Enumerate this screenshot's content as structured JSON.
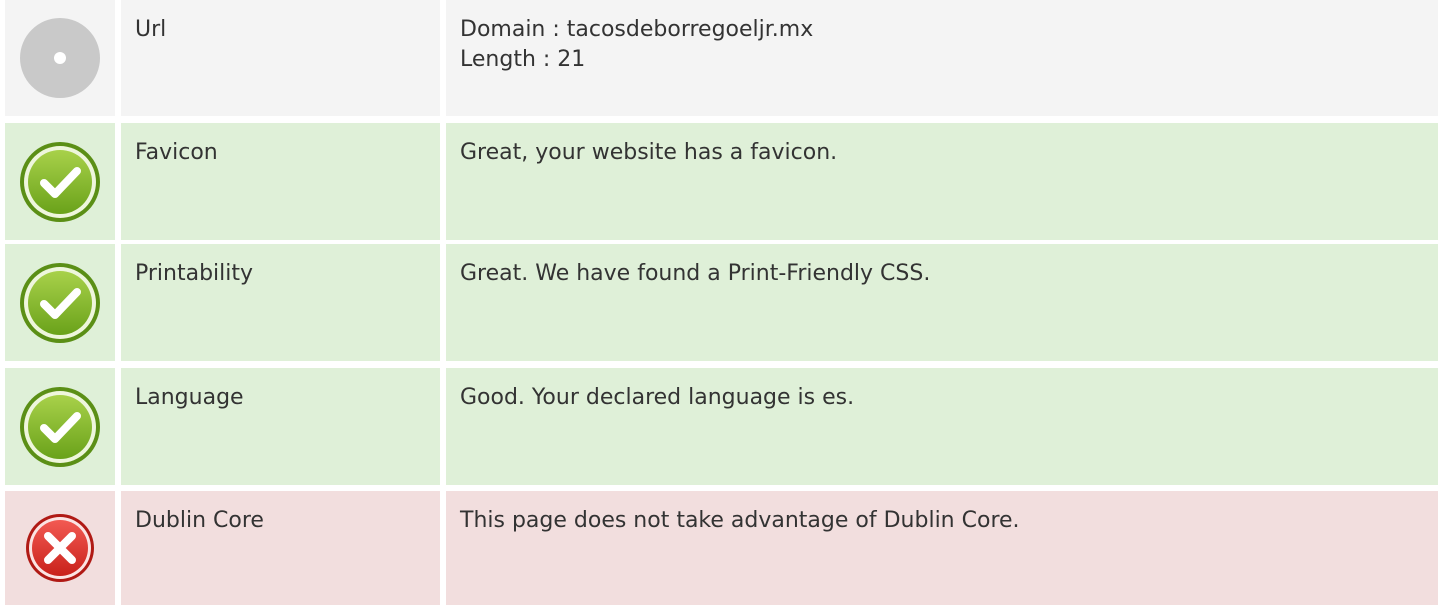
{
  "rows": [
    {
      "status": "neutral",
      "icon": "gray-circle-icon",
      "label": "Url",
      "value_lines": [
        "Domain : tacosdeborregoeljr.mx",
        "Length : 21"
      ],
      "colors": {
        "bg": "#f4f4f4"
      }
    },
    {
      "status": "pass",
      "icon": "check-circle-icon",
      "label": "Favicon",
      "value_lines": [
        "Great, your website has a favicon."
      ],
      "colors": {
        "bg": "#dff0d8"
      }
    },
    {
      "status": "pass",
      "icon": "check-circle-icon",
      "label": "Printability",
      "value_lines": [
        "Great. We have found a Print-Friendly CSS."
      ],
      "colors": {
        "bg": "#dff0d8"
      }
    },
    {
      "status": "pass",
      "icon": "check-circle-icon",
      "label": "Language",
      "value_lines": [
        "Good. Your declared language is es."
      ],
      "colors": {
        "bg": "#dff0d8"
      }
    },
    {
      "status": "fail",
      "icon": "error-x-icon",
      "label": "Dublin Core",
      "value_lines": [
        "This page does not take advantage of Dublin Core."
      ],
      "colors": {
        "bg": "#f2dede"
      }
    }
  ]
}
